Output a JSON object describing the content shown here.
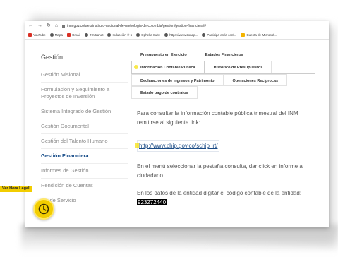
{
  "browser": {
    "url": "inm.gov.co/web/instituto-nacional-de-metrologia-de-colombia/gestion/gestion-financiera/#",
    "bookmarks": [
      {
        "label": "YouTube",
        "icon": "youtube-icon"
      },
      {
        "label": "Mapa",
        "icon": "maps-icon"
      },
      {
        "label": "Gmail",
        "icon": "gmail-icon"
      },
      {
        "label": "INMtranet",
        "icon": "globe-icon"
      },
      {
        "label": "Inducción ® 5",
        "icon": "globe-icon"
      },
      {
        "label": "Ophelia Suite",
        "icon": "globe-icon"
      },
      {
        "label": "https://www.zonap...",
        "icon": "globe-icon"
      },
      {
        "label": "Participa en la conf...",
        "icon": "globe-icon"
      },
      {
        "label": "Cuenta de Microsof...",
        "icon": "folder-icon"
      }
    ]
  },
  "sidebar": {
    "title": "Gestión",
    "items": [
      {
        "label": "Gestión Misional"
      },
      {
        "label": "Formulación y Seguimiento a Proyectos de Inversión"
      },
      {
        "label": "Sistema Integrado de Gestión"
      },
      {
        "label": "Gestión Documental"
      },
      {
        "label": "Gestión del Talento Humano"
      },
      {
        "label": "Gestión Financiera",
        "active": true
      },
      {
        "label": "Informes de Gestión"
      },
      {
        "label": "Rendición de Cuentas"
      },
      {
        "label": "...a de Servicio"
      }
    ]
  },
  "tabs": {
    "row1": [
      "Presupuesto en Ejercicio",
      "Estados Financieros"
    ],
    "row2": [
      "Información Contable Pública",
      "Histórico de Presupuestos"
    ],
    "row3": [
      "Declaraciones de Ingresos y Patrimonio",
      "Operaciones Recíprocas"
    ],
    "row4": [
      "Estado pago de contratos"
    ],
    "active": "Información Contable Pública"
  },
  "content": {
    "para1": "Para consultar la información contable pública trimestral del INM remitirse al siguiente link:",
    "link": "http://www.chip.gov.co/schip_rt/",
    "para2": "En el menú seleccionar la pestaña consulta, dar click en informe al ciudadano.",
    "para3": "En los datos de la entidad digitar el código contable de la entidad:",
    "code": "923272440"
  },
  "widget": {
    "label": "Ver Hora Legal",
    "icon": "clock-icon",
    "color": "#f2cd00"
  }
}
